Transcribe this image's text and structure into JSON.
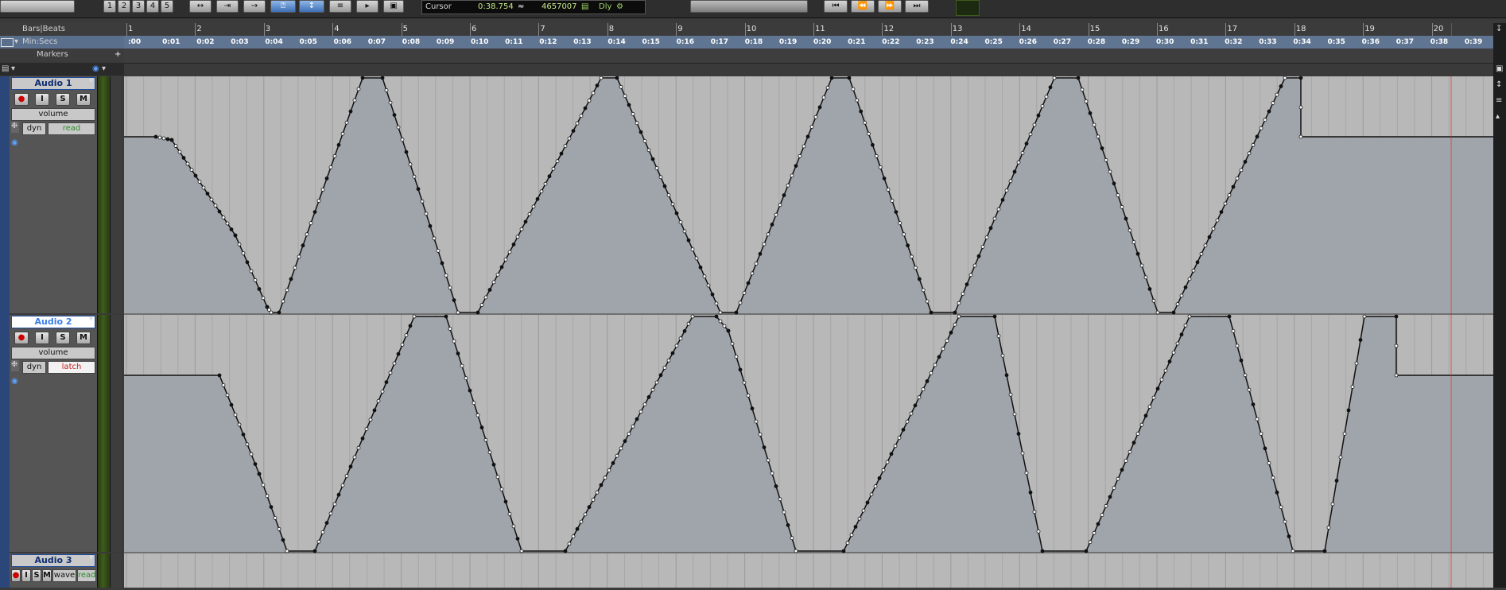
{
  "toolbar": {
    "zoom_presets": [
      "1",
      "2",
      "3",
      "4",
      "5"
    ],
    "counter_label": "Cursor",
    "counter_time": "0:38.754",
    "counter_samples": "4657007",
    "dly_label": "Dly"
  },
  "rulers": {
    "bars_label": "Bars|Beats",
    "min_label": "Min:Secs",
    "markers_label": "Markers",
    "bars": [
      "1",
      "2",
      "3",
      "4",
      "5",
      "6",
      "7",
      "8",
      "9",
      "10",
      "11",
      "12",
      "13",
      "14",
      "15",
      "16",
      "17",
      "18",
      "19",
      "20"
    ],
    "mins": [
      ":00",
      "0:01",
      "0:02",
      "0:03",
      "0:04",
      "0:05",
      "0:06",
      "0:07",
      "0:08",
      "0:09",
      "0:10",
      "0:11",
      "0:12",
      "0:13",
      "0:14",
      "0:15",
      "0:16",
      "0:17",
      "0:18",
      "0:19",
      "0:20",
      "0:21",
      "0:22",
      "0:23",
      "0:24",
      "0:25",
      "0:26",
      "0:27",
      "0:28",
      "0:29",
      "0:30",
      "0:31",
      "0:32",
      "0:33",
      "0:34",
      "0:35",
      "0:36",
      "0:37",
      "0:38",
      "0:39"
    ]
  },
  "tracks": [
    {
      "name": "Audio 1",
      "view": "volume",
      "dyn": "dyn",
      "mode": "read",
      "mode_color": "#2e8b2e",
      "rec": "●",
      "input": "I",
      "solo": "S",
      "mute": "M"
    },
    {
      "name": "Audio 2",
      "view": "volume",
      "dyn": "dyn",
      "mode": "latch",
      "mode_color": "#c22020",
      "rec": "●",
      "input": "I",
      "solo": "S",
      "mute": "M"
    },
    {
      "name": "Audio 3",
      "view": "wave",
      "dyn": "",
      "mode": "read",
      "mode_color": "#2e8b2e",
      "rec": "●",
      "input": "I",
      "solo": "S",
      "mute": "M"
    }
  ],
  "icons": {
    "gear": "gear-icon",
    "transport": [
      "rewind-to-start-icon",
      "rewind-icon",
      "fast-forward-icon",
      "go-to-end-icon"
    ]
  },
  "colors": {
    "automation_fill": "#a2a7ad",
    "lane_bg": "#b7b7b7",
    "selected_name": "#3a7de6"
  }
}
